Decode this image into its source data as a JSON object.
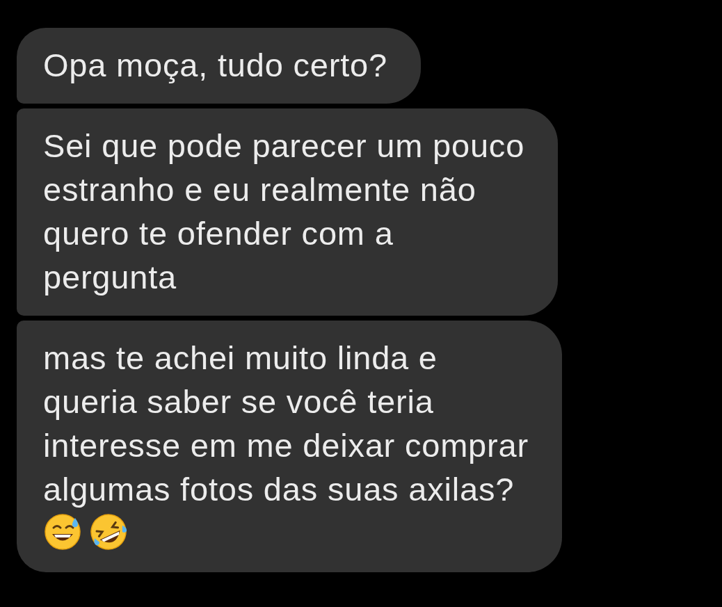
{
  "messages": [
    {
      "text": "Opa moça, tudo certo?",
      "kind": "first"
    },
    {
      "text": "Sei que pode parecer um pouco\nestranho e eu realmente não\nquero te ofender com a\npergunta",
      "kind": "middle"
    },
    {
      "text": "mas te achei muito linda e\nqueria saber se você teria\ninteresse em me deixar comprar\nalgumas fotos das suas axilas?",
      "kind": "last",
      "emojis": [
        {
          "kind": "sweat_smile"
        },
        {
          "kind": "rolling_laugh"
        }
      ]
    }
  ]
}
